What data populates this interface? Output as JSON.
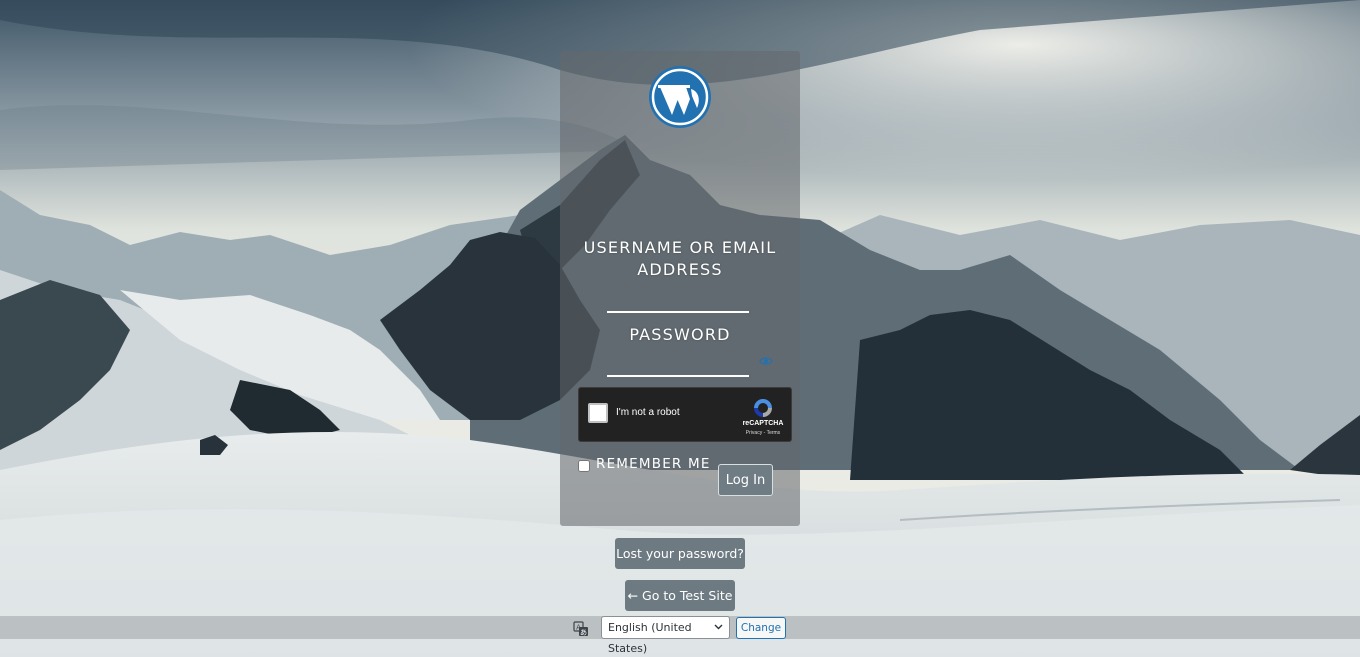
{
  "login_form": {
    "username_label": "USERNAME OR EMAIL ADDRESS",
    "username_value": "",
    "password_label": "PASSWORD",
    "password_value": "",
    "remember_label": "REMEMBER ME",
    "remember_checked": false,
    "submit_label": "Log In"
  },
  "recaptcha": {
    "checkbox_label": "I'm not a robot",
    "brand": "reCAPTCHA",
    "privacy_link": "Privacy",
    "separator": " - ",
    "terms_link": "Terms"
  },
  "links": {
    "lost_password": "Lost your password?",
    "back_to_site": "← Go to Test Site"
  },
  "language_switcher": {
    "selected": "English (United States)",
    "change_label": "Change"
  },
  "icons": {
    "logo": "wordpress-logo",
    "eye": "eye-icon",
    "translate": "translate-icon",
    "chevron": "chevron-down-icon"
  },
  "colors": {
    "wordpress_blue": "#2271b1",
    "panel_overlay": "#64686c",
    "button_gray": "#6d7a82"
  }
}
